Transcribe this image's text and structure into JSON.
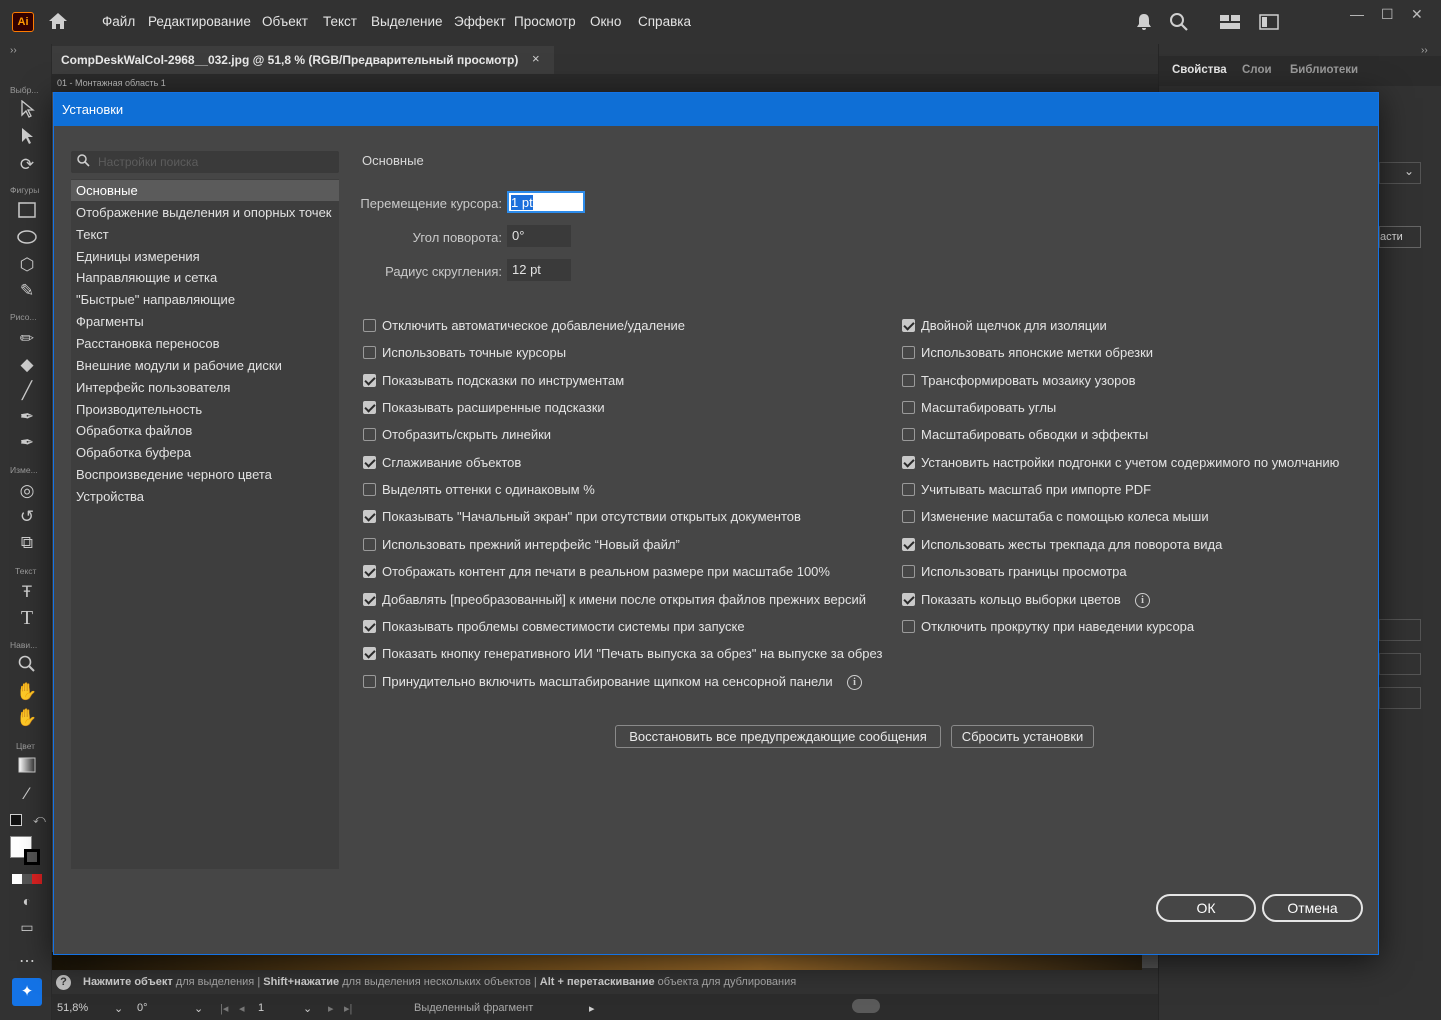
{
  "app": {
    "logo": "Ai"
  },
  "menu": [
    "Файл",
    "Редактирование",
    "Объект",
    "Текст",
    "Выделение",
    "Эффект",
    "Просмотр",
    "Окно",
    "Справка"
  ],
  "toolbar": {
    "labels": [
      "Выбр...",
      "Фигуры",
      "Рисо...",
      "Изме...",
      "Текст",
      "Нави...",
      "Цвет"
    ]
  },
  "document": {
    "tab_title": "CompDeskWalCol-2968__032.jpg @ 51,8 % (RGB/Предварительный просмотр)",
    "close": "×",
    "artboard": "01 - Монтажная область 1"
  },
  "right_panel": {
    "tabs": [
      "Свойства",
      "Слои",
      "Библиотеки"
    ],
    "partial_text": "асти"
  },
  "dialog": {
    "title": "Установки",
    "search_placeholder": "Настройки поиска",
    "categories": [
      "Основные",
      "Отображение выделения и опорных точек",
      "Текст",
      "Единицы измерения",
      "Направляющие и сетка",
      "\"Быстрые\" направляющие",
      "Фрагменты",
      "Расстановка переносов",
      "Внешние модули и рабочие диски",
      "Интерфейс пользователя",
      "Производительность",
      "Обработка файлов",
      "Обработка буфера",
      "Воспроизведение черного цвета",
      "Устройства"
    ],
    "section_title": "Основные",
    "fields": {
      "cursor_label": "Перемещение курсора:",
      "cursor_value": "1 pt",
      "angle_label": "Угол поворота:",
      "angle_value": "0°",
      "radius_label": "Радиус скругления:",
      "radius_value": "12 pt"
    },
    "left_checkboxes": [
      {
        "label": "Отключить автоматическое добавление/удаление",
        "checked": false
      },
      {
        "label": "Использовать точные курсоры",
        "checked": false
      },
      {
        "label": "Показывать подсказки по инструментам",
        "checked": true
      },
      {
        "label": "Показывать расширенные подсказки",
        "checked": true
      },
      {
        "label": "Отобразить/скрыть линейки",
        "checked": false
      },
      {
        "label": "Сглаживание объектов",
        "checked": true
      },
      {
        "label": "Выделять оттенки с одинаковым %",
        "checked": false
      },
      {
        "label": "Показывать \"Начальный экран\" при отсутствии открытых документов",
        "checked": true
      },
      {
        "label": "Использовать прежний интерфейс “Новый файл”",
        "checked": false
      },
      {
        "label": "Отображать контент для печати в реальном размере при масштабе 100%",
        "checked": true
      },
      {
        "label": "Добавлять [преобразованный] к имени после открытия файлов прежних версий",
        "checked": true
      },
      {
        "label": "Показывать проблемы совместимости системы при запуске",
        "checked": true
      },
      {
        "label": "Показать кнопку генеративного ИИ \"Печать выпуска за обрез\" на выпуске за обрез",
        "checked": true
      },
      {
        "label": "Принудительно включить масштабирование щипком на сенсорной панели",
        "checked": false
      }
    ],
    "right_checkboxes": [
      {
        "label": "Двойной щелчок для изоляции",
        "checked": true
      },
      {
        "label": "Использовать японские метки обрезки",
        "checked": false
      },
      {
        "label": "Трансформировать мозаику узоров",
        "checked": false
      },
      {
        "label": "Масштабировать углы",
        "checked": false
      },
      {
        "label": "Масштабировать обводки и эффекты",
        "checked": false
      },
      {
        "label": "Установить настройки подгонки с учетом содержимого по умолчанию",
        "checked": true
      },
      {
        "label": "Учитывать масштаб при импорте PDF",
        "checked": false
      },
      {
        "label": "Изменение масштаба с помощью колеса мыши",
        "checked": false
      },
      {
        "label": "Использовать жесты трекпада для поворота вида",
        "checked": true
      },
      {
        "label": "Использовать границы просмотра",
        "checked": false
      },
      {
        "label": "Показать кольцо выборки цветов",
        "checked": true
      },
      {
        "label": "Отключить прокрутку при наведении курсора",
        "checked": false
      }
    ],
    "info_glyph": "i",
    "buttons": {
      "restore_warnings": "Восстановить все предупреждающие сообщения",
      "reset": "Сбросить установки",
      "ok": "ОК",
      "cancel": "Отмена"
    }
  },
  "hint": {
    "b1": "Нажмите объект",
    "t1": " для выделения  |  ",
    "b2": "Shift+нажатие",
    "t2": " для выделения нескольких объектов  |  ",
    "b3": "Alt + перетаскивание",
    "t3": " объекта для дублирования"
  },
  "status": {
    "zoom": "51,8%",
    "angle": "0°",
    "artboard_num": "1",
    "selection": "Выделенный фрагмент"
  },
  "colors": {
    "accent": "#0f6fd6",
    "dialog_bg": "#464646",
    "app_bg": "#323232"
  }
}
